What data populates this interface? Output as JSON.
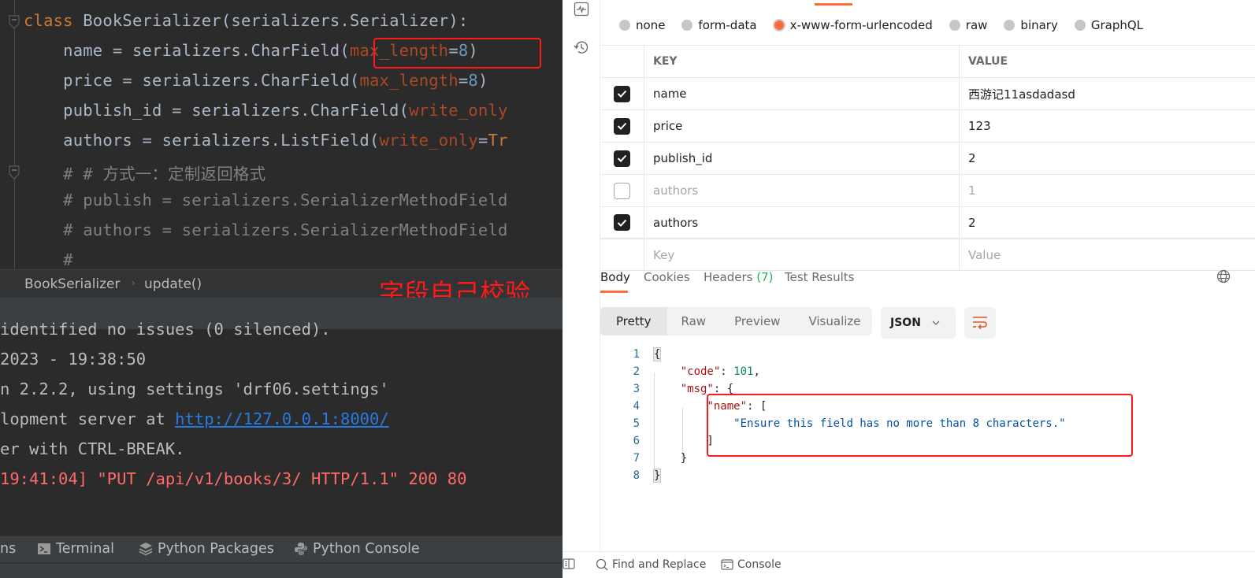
{
  "ide": {
    "code_lines": [
      {
        "parts": [
          {
            "t": "class ",
            "c": "kw"
          },
          {
            "t": "BookSerializer(serializers.Serializer):",
            "c": ""
          }
        ]
      },
      {
        "parts": [
          {
            "t": "    name = serializers.CharField(",
            "c": ""
          },
          {
            "t": "max_length",
            "c": "param"
          },
          {
            "t": "=",
            "c": ""
          },
          {
            "t": "8",
            "c": "num"
          },
          {
            "t": ")",
            "c": ""
          }
        ]
      },
      {
        "parts": [
          {
            "t": "    price = serializers.CharField(",
            "c": ""
          },
          {
            "t": "max_length",
            "c": "param"
          },
          {
            "t": "=",
            "c": ""
          },
          {
            "t": "8",
            "c": "num"
          },
          {
            "t": ")",
            "c": ""
          }
        ]
      },
      {
        "parts": [
          {
            "t": "    publish_id = serializers.CharField(",
            "c": ""
          },
          {
            "t": "write_only",
            "c": "param"
          }
        ]
      },
      {
        "parts": [
          {
            "t": "    authors = serializers.ListField(",
            "c": ""
          },
          {
            "t": "write_only",
            "c": "param"
          },
          {
            "t": "=",
            "c": ""
          },
          {
            "t": "Tr",
            "c": "kw"
          }
        ]
      },
      {
        "parts": [
          {
            "t": "    # # 方式一：定制返回格式",
            "c": "cmt"
          }
        ]
      },
      {
        "parts": [
          {
            "t": "    # publish = serializers.SerializerMethodField",
            "c": "cmt"
          }
        ]
      },
      {
        "parts": [
          {
            "t": "    # authors = serializers.SerializerMethodField",
            "c": "cmt"
          }
        ]
      },
      {
        "parts": [
          {
            "t": "    #",
            "c": "cmt"
          }
        ]
      }
    ],
    "breadcrumb": {
      "class_name": "BookSerializer",
      "method": "update()",
      "separator": "›"
    },
    "annotation_label": "字段自己校验",
    "console_lines": [
      {
        "text": "identified no issues (0 silenced).",
        "type": "normal"
      },
      {
        "text": "2023 - 19:38:50",
        "type": "normal"
      },
      {
        "text": "n 2.2.2, using settings 'drf06.settings'",
        "type": "normal"
      },
      {
        "text_before": "lopment server at ",
        "link": "http://127.0.0.1:8000/",
        "type": "link"
      },
      {
        "text": "er with CTRL-BREAK.",
        "type": "normal"
      },
      {
        "text": "19:41:04] \"PUT /api/v1/books/3/ HTTP/1.1\" 200 80",
        "type": "err"
      }
    ],
    "tool_tabs": [
      {
        "label": "ns",
        "icon": "none"
      },
      {
        "label": "Terminal",
        "icon": "terminal-icon"
      },
      {
        "label": "Python Packages",
        "icon": "layers-icon"
      },
      {
        "label": "Python Console",
        "icon": "python-icon"
      }
    ]
  },
  "postman": {
    "body_types": [
      {
        "label": "none",
        "selected": false
      },
      {
        "label": "form-data",
        "selected": false
      },
      {
        "label": "x-www-form-urlencoded",
        "selected": true
      },
      {
        "label": "raw",
        "selected": false
      },
      {
        "label": "binary",
        "selected": false
      },
      {
        "label": "GraphQL",
        "selected": false
      }
    ],
    "table": {
      "headers": {
        "key": "KEY",
        "value": "VALUE"
      },
      "rows": [
        {
          "key": "name",
          "value": "西游记11asdadasd",
          "checked": true
        },
        {
          "key": "price",
          "value": "123",
          "checked": true
        },
        {
          "key": "publish_id",
          "value": "2",
          "checked": true
        },
        {
          "key": "authors",
          "value": "1",
          "checked": false
        },
        {
          "key": "authors",
          "value": "2",
          "checked": true
        }
      ],
      "placeholder": {
        "key": "Key",
        "value": "Value"
      }
    },
    "response_tabs": {
      "body": "Body",
      "cookies": "Cookies",
      "headers": "Headers",
      "headers_count": "(7)",
      "test_results": "Test Results"
    },
    "view_modes": [
      "Pretty",
      "Raw",
      "Preview",
      "Visualize"
    ],
    "active_view_mode": "Pretty",
    "format": "JSON",
    "response_json_lines": [
      {
        "n": "1",
        "parts": [
          {
            "t": "{",
            "c": "jp hl"
          }
        ]
      },
      {
        "n": "2",
        "parts": [
          {
            "t": "    ",
            "c": "jp"
          },
          {
            "t": "\"code\"",
            "c": "jk"
          },
          {
            "t": ": ",
            "c": "jp"
          },
          {
            "t": "101",
            "c": "jn"
          },
          {
            "t": ",",
            "c": "jp"
          }
        ]
      },
      {
        "n": "3",
        "parts": [
          {
            "t": "    ",
            "c": "jp"
          },
          {
            "t": "\"msg\"",
            "c": "jk"
          },
          {
            "t": ": {",
            "c": "jp"
          }
        ]
      },
      {
        "n": "4",
        "parts": [
          {
            "t": "        ",
            "c": "jp"
          },
          {
            "t": "\"name\"",
            "c": "jk"
          },
          {
            "t": ": [",
            "c": "jp"
          }
        ]
      },
      {
        "n": "5",
        "parts": [
          {
            "t": "            ",
            "c": "jp"
          },
          {
            "t": "\"Ensure this field has no more than 8 characters.\"",
            "c": "js"
          }
        ]
      },
      {
        "n": "6",
        "parts": [
          {
            "t": "        ]",
            "c": "jp"
          }
        ]
      },
      {
        "n": "7",
        "parts": [
          {
            "t": "    }",
            "c": "jp"
          }
        ]
      },
      {
        "n": "8",
        "parts": [
          {
            "t": "}",
            "c": "jp hl"
          }
        ]
      }
    ],
    "bottom_bar": {
      "find_replace": "Find and Replace",
      "console": "Console"
    },
    "accent_color": "#ff6c37"
  }
}
